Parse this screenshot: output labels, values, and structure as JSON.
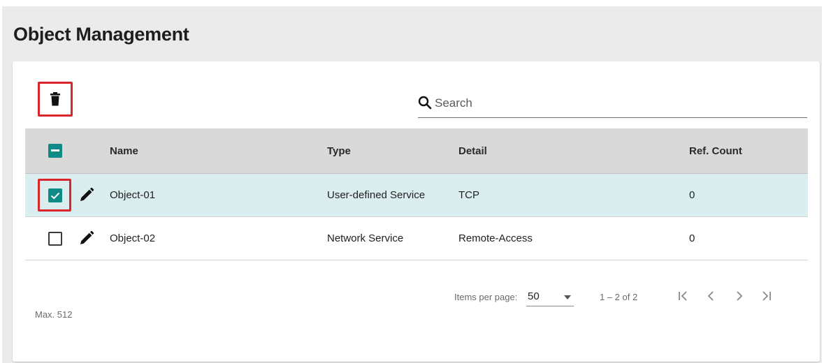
{
  "page": {
    "title": "Object Management"
  },
  "toolbar": {
    "delete_icon": "trash-icon",
    "delete_highlighted": true
  },
  "search": {
    "placeholder": "Search",
    "value": ""
  },
  "table": {
    "columns": [
      "Name",
      "Type",
      "Detail",
      "Ref. Count"
    ],
    "header_checkbox_state": "indeterminate",
    "rows": [
      {
        "name": "Object-01",
        "type": "User-defined Service",
        "detail": "TCP",
        "ref_count": "0",
        "checked": true,
        "highlighted": true
      },
      {
        "name": "Object-02",
        "type": "Network Service",
        "detail": "Remote-Access",
        "ref_count": "0",
        "checked": false,
        "highlighted": false
      }
    ]
  },
  "footer": {
    "max_label": "Max. 512",
    "items_per_page_label": "Items per page:",
    "items_per_page_value": "50",
    "range_label": "1 – 2 of 2"
  },
  "colors": {
    "accent": "#0f8a86",
    "highlight_border": "#d9262c",
    "selected_row": "#dbeeef",
    "header_bg": "#d9d9d9"
  }
}
